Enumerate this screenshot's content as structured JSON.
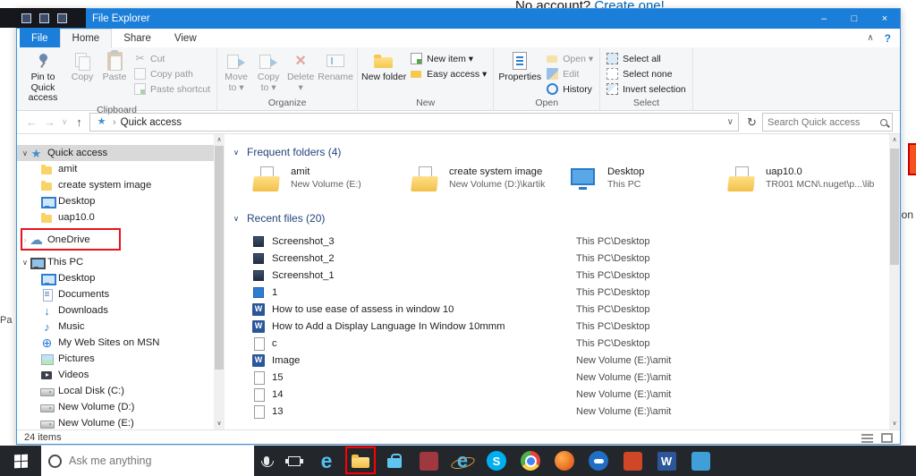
{
  "background": {
    "top_text": "No account?",
    "top_link": "Create one!",
    "right_text": "on",
    "left_text": "Pa"
  },
  "colors": {
    "accent": "#1b7ed8",
    "annotation_red": "#e8131d",
    "taskbar": "#23262b",
    "folder_yellow": "#fbd268"
  },
  "glyphs": {
    "minimize": "–",
    "maximize": "□",
    "close": "×",
    "help": "?",
    "collapse": "∧",
    "back": "←",
    "forward": "→",
    "up": "↑",
    "dropdown": "∨",
    "dropdown_small": "▾",
    "refresh": "↻",
    "chevron_expanded": "∨",
    "chevron_collapsed": "›",
    "breadcrumb_arrow": "›",
    "star": "★",
    "cloud": "☁",
    "music": "♪",
    "download": "↓",
    "globe": "⊕",
    "cut_icon": "✂",
    "scroll_up": "∧",
    "scroll_down": "∨"
  },
  "window": {
    "title": "File Explorer",
    "tabs": {
      "file": "File",
      "home": "Home",
      "share": "Share",
      "view": "View"
    },
    "ribbon": {
      "clipboard": {
        "label": "Clipboard",
        "pin": "Pin to Quick access",
        "copy": "Copy",
        "paste": "Paste",
        "cut": "Cut",
        "copy_path": "Copy path",
        "paste_shortcut": "Paste shortcut"
      },
      "organize": {
        "label": "Organize",
        "move_to": "Move to ▾",
        "copy_to": "Copy to ▾",
        "delete": "Delete ▾",
        "rename": "Rename"
      },
      "new": {
        "label": "New",
        "new_folder": "New folder",
        "new_item": "New item ▾",
        "easy_access": "Easy access ▾"
      },
      "open": {
        "label": "Open",
        "properties": "Properties",
        "open": "Open ▾",
        "edit": "Edit",
        "history": "History"
      },
      "select": {
        "label": "Select",
        "select_all": "Select all",
        "select_none": "Select none",
        "invert_selection": "Invert selection"
      }
    },
    "address": {
      "location": "Quick access",
      "search_placeholder": "Search Quick access"
    },
    "sidebar": {
      "items": [
        {
          "label": "Quick access",
          "icon": "star"
        },
        {
          "label": "amit",
          "icon": "folder"
        },
        {
          "label": "create system image",
          "icon": "folder"
        },
        {
          "label": "Desktop",
          "icon": "desktop"
        },
        {
          "label": "uap10.0",
          "icon": "folder"
        },
        {
          "label": "OneDrive",
          "icon": "cloud"
        },
        {
          "label": "This PC",
          "icon": "computer"
        },
        {
          "label": "Desktop",
          "icon": "desktop"
        },
        {
          "label": "Documents",
          "icon": "document"
        },
        {
          "label": "Downloads",
          "icon": "download-arrow"
        },
        {
          "label": "Music",
          "icon": "music-note"
        },
        {
          "label": "My Web Sites on MSN",
          "icon": "globe"
        },
        {
          "label": "Pictures",
          "icon": "picture"
        },
        {
          "label": "Videos",
          "icon": "video"
        },
        {
          "label": "Local Disk (C:)",
          "icon": "drive"
        },
        {
          "label": "New Volume (D:)",
          "icon": "drive"
        },
        {
          "label": "New Volume (E:)",
          "icon": "drive"
        }
      ]
    },
    "main": {
      "frequent_header": "Frequent folders (4)",
      "frequent": [
        {
          "name": "amit",
          "path": "New Volume (E:)"
        },
        {
          "name": "create system image",
          "path": "New Volume (D:)\\kartik"
        },
        {
          "name": "Desktop",
          "path": "This PC"
        },
        {
          "name": "uap10.0",
          "path": "TR001 MCN\\.nuget\\p...\\lib"
        }
      ],
      "recent_header": "Recent files (20)",
      "recent": [
        {
          "name": "Screenshot_3",
          "path": "This PC\\Desktop"
        },
        {
          "name": "Screenshot_2",
          "path": "This PC\\Desktop"
        },
        {
          "name": "Screenshot_1",
          "path": "This PC\\Desktop"
        },
        {
          "name": "1",
          "path": "This PC\\Desktop"
        },
        {
          "name": "How to use ease of assess in window 10",
          "path": "This PC\\Desktop"
        },
        {
          "name": "How to Add a Display Language In Window 10mmm",
          "path": "This PC\\Desktop"
        },
        {
          "name": "c",
          "path": "This PC\\Desktop"
        },
        {
          "name": "Image",
          "path": "New Volume (E:)\\amit"
        },
        {
          "name": "15",
          "path": "New Volume (E:)\\amit"
        },
        {
          "name": "14",
          "path": "New Volume (E:)\\amit"
        },
        {
          "name": "13",
          "path": "New Volume (E:)\\amit"
        }
      ]
    },
    "status": "24 items"
  },
  "taskbar": {
    "search_placeholder": "Ask me anything",
    "icons": [
      {
        "name": "edge",
        "glyph": "e"
      },
      {
        "name": "file-explorer",
        "glyph": ""
      },
      {
        "name": "store",
        "glyph": ""
      },
      {
        "name": "maroon-app",
        "glyph": ""
      },
      {
        "name": "internet-explorer",
        "glyph": "e"
      },
      {
        "name": "skype",
        "glyph": "S"
      },
      {
        "name": "chrome",
        "glyph": ""
      },
      {
        "name": "firefox",
        "glyph": ""
      },
      {
        "name": "blue-round-app",
        "glyph": ""
      },
      {
        "name": "orange-app",
        "glyph": ""
      },
      {
        "name": "word",
        "glyph": "W"
      },
      {
        "name": "light-blue-app",
        "glyph": ""
      }
    ]
  }
}
